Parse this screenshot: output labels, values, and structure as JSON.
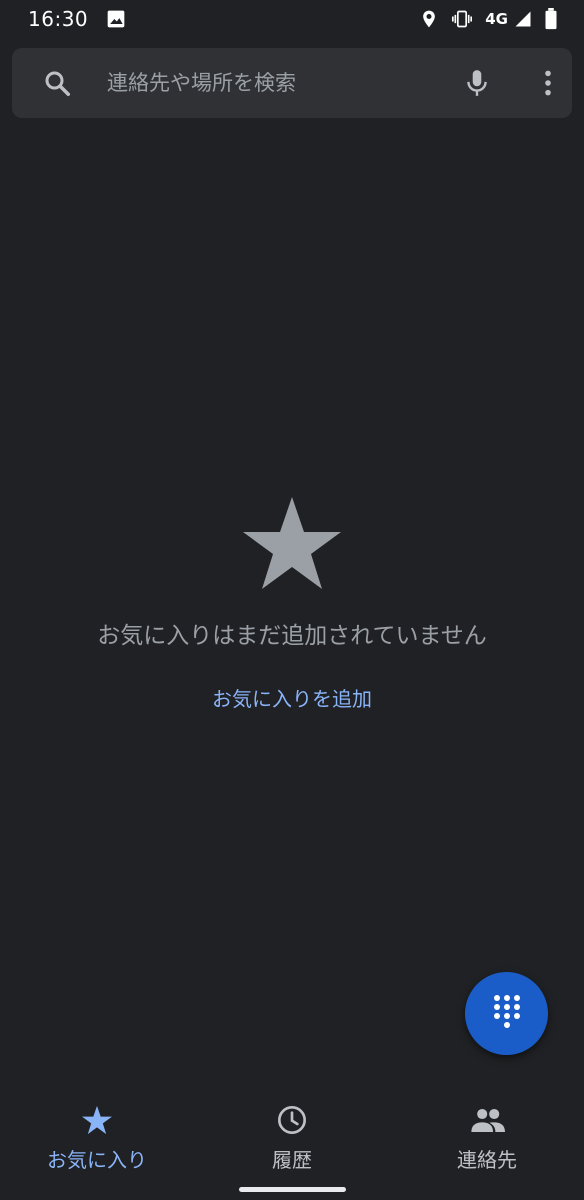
{
  "status_bar": {
    "time": "16:30",
    "network": "4G",
    "icons": [
      "image-icon",
      "location-icon",
      "vibrate-icon",
      "signal-icon",
      "battery-icon"
    ]
  },
  "search": {
    "placeholder": "連絡先や場所を検索",
    "icons": [
      "search-icon",
      "mic-icon",
      "more-vert-icon"
    ]
  },
  "empty_state": {
    "icon": "star-icon",
    "message": "お気に入りはまだ追加されていません",
    "action_label": "お気に入りを追加"
  },
  "fab": {
    "icon": "dialpad-icon"
  },
  "bottom_nav": {
    "items": [
      {
        "label": "お気に入り",
        "icon": "star-icon",
        "active": true
      },
      {
        "label": "履歴",
        "icon": "clock-icon",
        "active": false
      },
      {
        "label": "連絡先",
        "icon": "people-icon",
        "active": false
      }
    ]
  },
  "colors": {
    "background": "#202124",
    "search_bar": "#303134",
    "accent": "#8ab4f8",
    "fab": "#1a5dc8",
    "muted_text": "#9aa0a6"
  }
}
